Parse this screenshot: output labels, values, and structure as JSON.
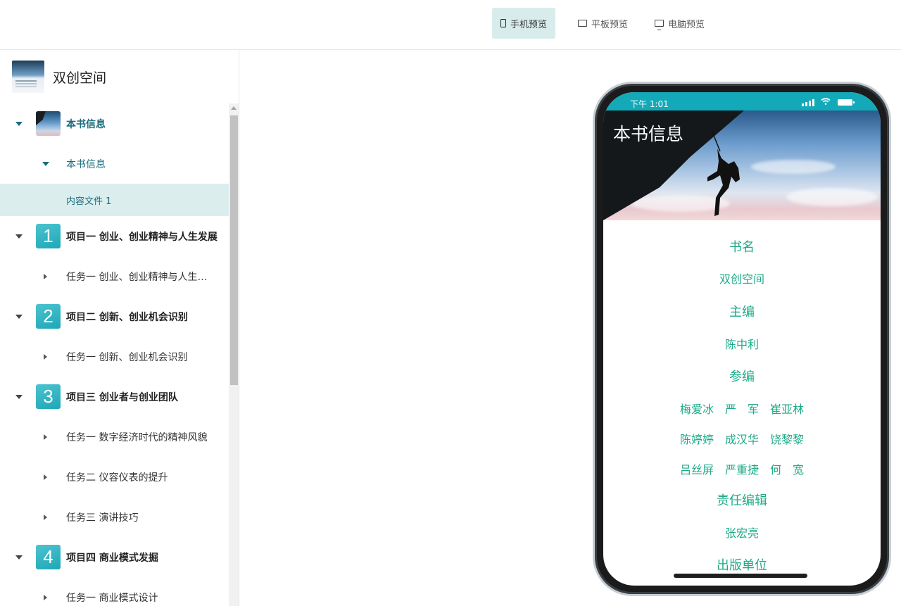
{
  "toolbar": {
    "phone_label": "手机预览",
    "tablet_label": "平板预览",
    "desktop_label": "电脑预览"
  },
  "book": {
    "title": "双创空间"
  },
  "tree": {
    "book_info": "本书信息",
    "book_info_sub": "本书信息",
    "content_file": "内容文件 1",
    "chapters": [
      {
        "num": "1",
        "title": "项目一 创业、创业精神与人生发展",
        "tasks": [
          "任务一 创业、创业精神与人生发展"
        ]
      },
      {
        "num": "2",
        "title": "项目二 创新、创业机会识别",
        "tasks": [
          "任务一 创新、创业机会识别"
        ]
      },
      {
        "num": "3",
        "title": "项目三 创业者与创业团队",
        "tasks": [
          "任务一 数字经济时代的精神风貌",
          "任务二 仪容仪表的提升",
          "任务三 演讲技巧"
        ]
      },
      {
        "num": "4",
        "title": "项目四 商业模式发掘",
        "tasks": [
          "任务一 商业模式设计"
        ]
      }
    ]
  },
  "phone": {
    "time": "下午 1:01",
    "banner_title": "本书信息",
    "fields": {
      "book_name_label": "书名",
      "book_name": "双创空间",
      "editor_label": "主编",
      "editor": "陈中利",
      "contributors_label": "参编",
      "contributors": [
        "梅爱冰　严　军　崔亚林",
        "陈婷婷　成汉华　饶黎黎",
        "吕丝屏　严重捷　何　宽"
      ],
      "resp_editor_label": "责任编辑",
      "resp_editor": "张宏亮",
      "publisher_label": "出版单位"
    }
  },
  "colors": {
    "accent": "#1faa87",
    "teal": "#13a9b8",
    "nav_active": "#dcedee",
    "nav_text": "#1b6d7e"
  }
}
